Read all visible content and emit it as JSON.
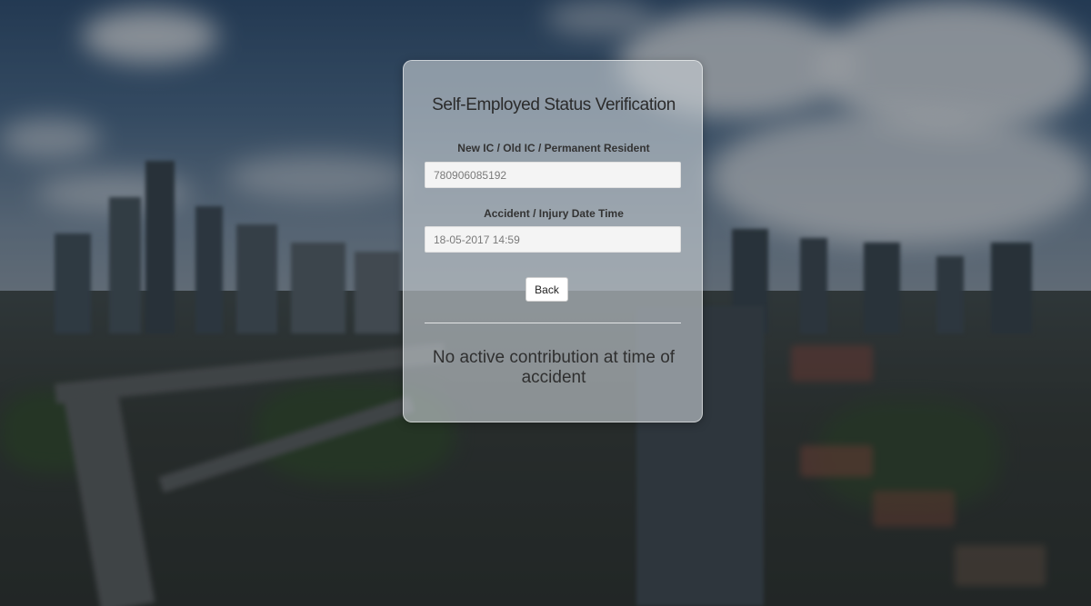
{
  "form": {
    "title": "Self-Employed Status Verification",
    "ic_label": "New IC / Old IC / Permanent Resident",
    "ic_value": "780906085192",
    "date_label": "Accident / Injury Date Time",
    "date_value": "18-05-2017 14:59",
    "back_label": "Back"
  },
  "result": {
    "message": "No active contribution at time of accident"
  }
}
